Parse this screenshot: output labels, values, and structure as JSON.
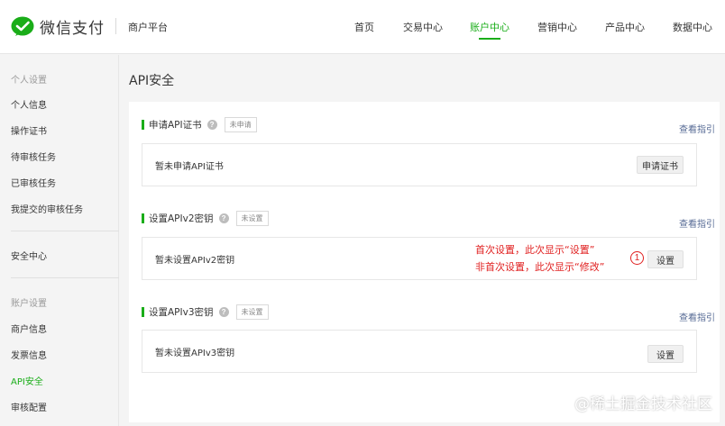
{
  "brand": {
    "name": "微信支付",
    "platform": "商户平台",
    "accent": "#1aad19"
  },
  "nav": {
    "items": [
      {
        "label": "首页",
        "active": false
      },
      {
        "label": "交易中心",
        "active": false
      },
      {
        "label": "账户中心",
        "active": true
      },
      {
        "label": "营销中心",
        "active": false
      },
      {
        "label": "产品中心",
        "active": false
      },
      {
        "label": "数据中心",
        "active": false
      }
    ]
  },
  "sidebar": {
    "group1": "个人设置",
    "group1_items": [
      "个人信息",
      "操作证书",
      "待审核任务",
      "已审核任务",
      "我提交的审核任务"
    ],
    "security_center": "安全中心",
    "group2": "账户设置",
    "group2_items": [
      "商户信息",
      "发票信息",
      "API安全",
      "审核配置"
    ],
    "active_item": "API安全"
  },
  "page": {
    "title": "API安全"
  },
  "sections": [
    {
      "title": "申请API证书",
      "help_icon": "question-circle-icon",
      "badge": "未申请",
      "guide": "查看指引",
      "box_text": "暂未申请API证书",
      "button": "申请证书"
    },
    {
      "title": "设置APIv2密钥",
      "help_icon": "question-circle-icon",
      "badge": "未设置",
      "guide": "查看指引",
      "box_text": "暂未设置APIv2密钥",
      "button": "设置"
    },
    {
      "title": "设置APIv3密钥",
      "help_icon": "question-circle-icon",
      "badge": "未设置",
      "guide": "查看指引",
      "box_text": "暂未设置APIv3密钥",
      "button": "设置"
    }
  ],
  "annotation": {
    "line1": "首次设置，此次显示“设置”",
    "line2": "非首次设置，此次显示“修改”",
    "marker": "①",
    "color": "#e02020"
  },
  "watermark": "@稀土掘金技术社区"
}
